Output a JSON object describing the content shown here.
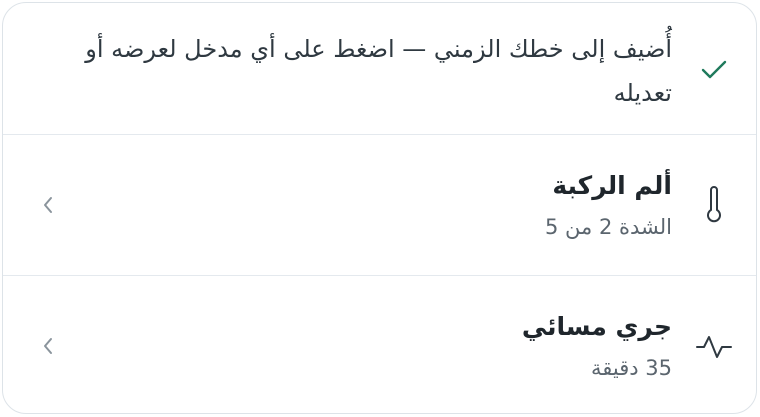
{
  "banner": {
    "icon": "check-icon",
    "text": "أُضيف إلى خطك الزمني — اضغط على أي مدخل لعرضه أو تعديله",
    "accent": "#1f7a5c"
  },
  "entries": [
    {
      "icon": "thermometer-icon",
      "title": "ألم الركبة",
      "subtitle": "الشدة 2 من 5"
    },
    {
      "icon": "activity-icon",
      "title": "جري مسائي",
      "subtitle": "35 دقيقة"
    }
  ],
  "colors": {
    "border": "#dde3e8",
    "title": "#1f262c",
    "subtitle": "#5b656e",
    "chevron": "#8a949c"
  }
}
